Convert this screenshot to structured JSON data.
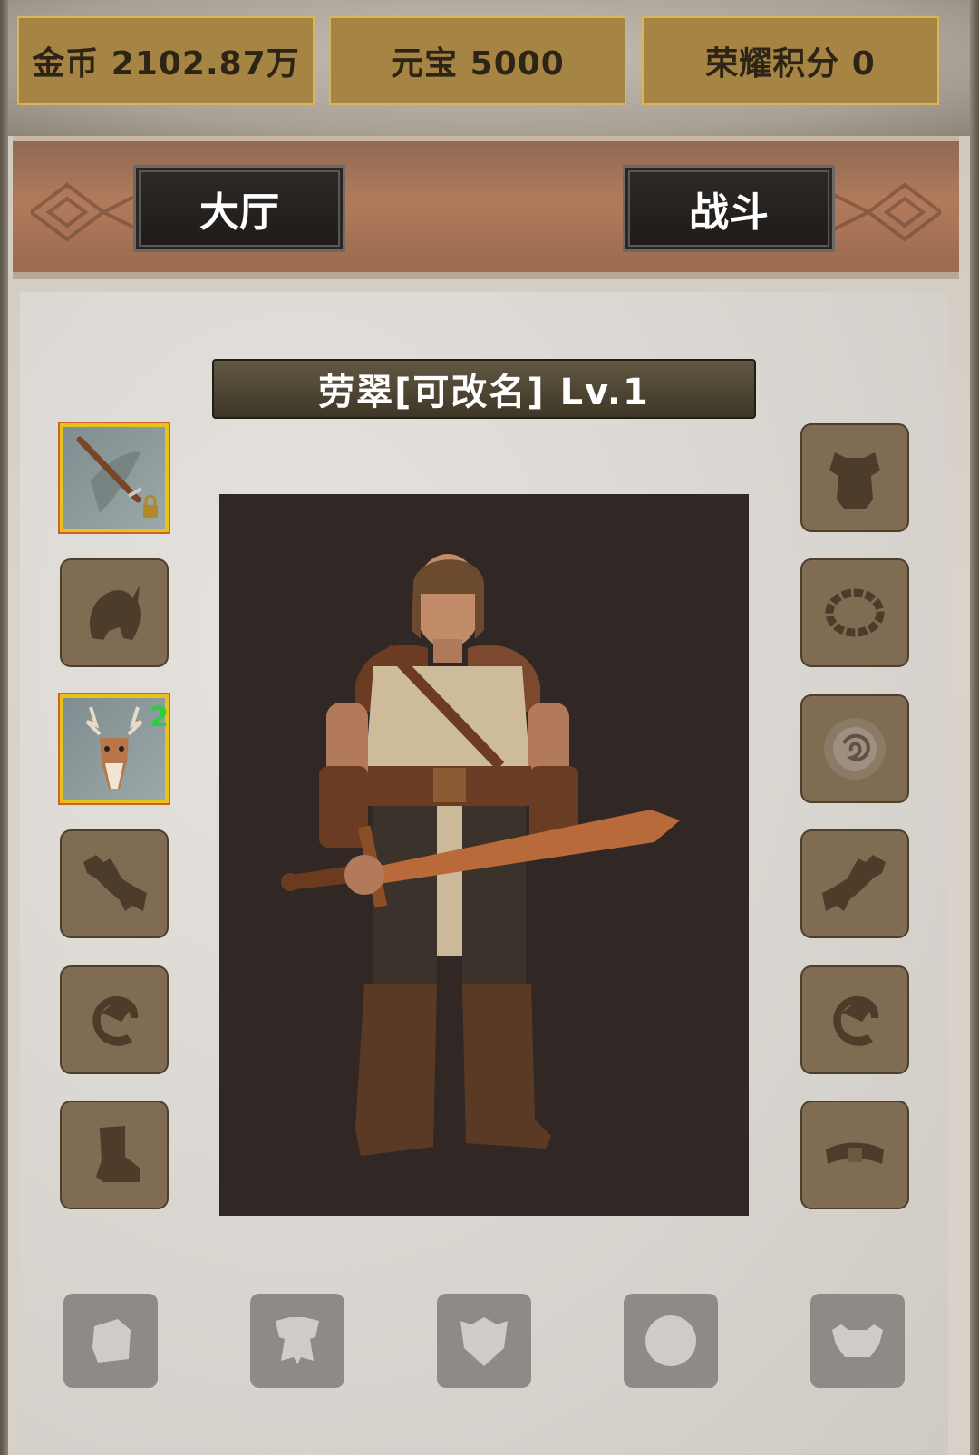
{
  "resources": {
    "gold": "金币 2102.87万",
    "yuanbao": "元宝 5000",
    "honor": "荣耀积分 0"
  },
  "nav": {
    "lobby": "大厅",
    "battle": "战斗"
  },
  "character": {
    "name_level": "劳翠[可改名] Lv.1"
  },
  "left_slots": [
    {
      "icon": "wooden-sword-equipped",
      "equipped": true
    },
    {
      "icon": "helmet-silhouette-icon",
      "equipped": false
    },
    {
      "icon": "deer-mount-equipped",
      "equipped": true,
      "badge": "2"
    },
    {
      "icon": "gauntlet-silhouette-icon",
      "equipped": false
    },
    {
      "icon": "ring-silhouette-icon",
      "equipped": false
    },
    {
      "icon": "boot-silhouette-icon",
      "equipped": false
    }
  ],
  "right_slots": [
    {
      "icon": "armor-silhouette-icon"
    },
    {
      "icon": "necklace-silhouette-icon"
    },
    {
      "icon": "dragon-medallion-icon"
    },
    {
      "icon": "gauntlet-silhouette-icon"
    },
    {
      "icon": "ring-silhouette-icon"
    },
    {
      "icon": "belt-silhouette-icon"
    }
  ],
  "bottom_slots": [
    {
      "icon": "fist-silhouette-icon"
    },
    {
      "icon": "cape-silhouette-icon"
    },
    {
      "icon": "shield-silhouette-icon"
    },
    {
      "icon": "orb-silhouette-icon"
    },
    {
      "icon": "beast-pet-silhouette-icon"
    }
  ],
  "colors": {
    "resource_bg": "#a68444",
    "slot_bg": "#806c52",
    "equipped_border": "#e6c21f",
    "badge_green": "#28d13a"
  }
}
